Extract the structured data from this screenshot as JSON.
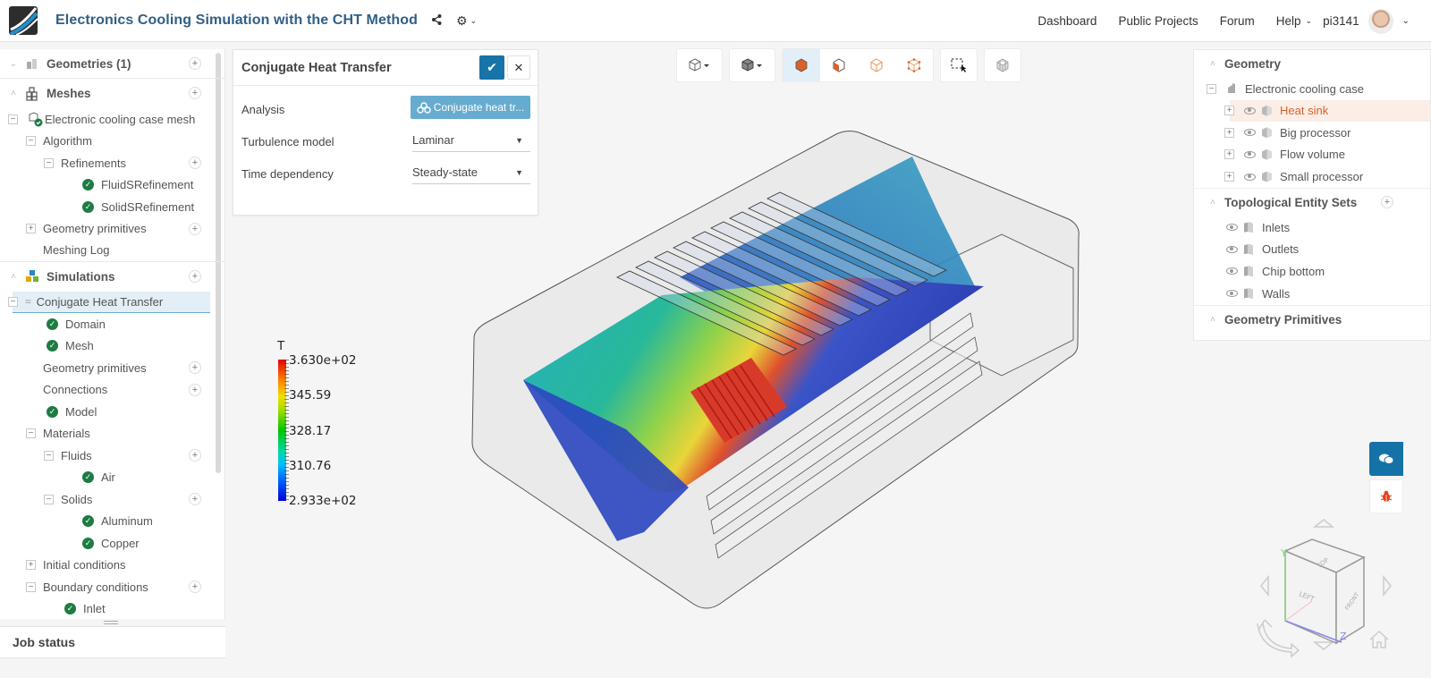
{
  "header": {
    "title": "Electronics Cooling Simulation with the CHT Method",
    "share_icon": "share-icon",
    "settings_icon": "gear-icon",
    "nav": [
      "Dashboard",
      "Public Projects",
      "Forum",
      "Help"
    ],
    "username": "pi3141"
  },
  "sidebar": {
    "geometries": "Geometries (1)",
    "meshes": "Meshes",
    "mesh_item": "Electronic cooling case mesh",
    "algorithm": "Algorithm",
    "refinements": "Refinements",
    "refinement_items": [
      "FluidSRefinement",
      "SolidSRefinement"
    ],
    "geometry_primitives": "Geometry primitives",
    "meshing_log": "Meshing Log",
    "simulations": "Simulations",
    "simulation_item": "Conjugate Heat Transfer",
    "domain": "Domain",
    "mesh": "Mesh",
    "sim_geometry_primitives": "Geometry primitives",
    "connections": "Connections",
    "model": "Model",
    "materials": "Materials",
    "fluids": "Fluids",
    "air": "Air",
    "solids": "Solids",
    "aluminum": "Aluminum",
    "copper": "Copper",
    "initial_conditions": "Initial conditions",
    "boundary_conditions": "Boundary conditions",
    "inlet": "Inlet",
    "job_status": "Job status"
  },
  "dialog": {
    "title": "Conjugate Heat Transfer",
    "analysis_label": "Analysis",
    "analysis_value": "Conjugate heat tr...",
    "turbulence_label": "Turbulence model",
    "turbulence_value": "Laminar",
    "time_label": "Time dependency",
    "time_value": "Steady-state"
  },
  "right_panel": {
    "geometry": "Geometry",
    "case": "Electronic cooling case",
    "parts": [
      "Heat sink",
      "Big processor",
      "Flow volume",
      "Small processor"
    ],
    "selected_part": "Heat sink",
    "topo_sets": "Topological Entity Sets",
    "sets": [
      "Inlets",
      "Outlets",
      "Chip bottom",
      "Walls"
    ],
    "geometry_primitives": "Geometry Primitives"
  },
  "colorbar": {
    "variable": "T",
    "labels": [
      "3.630e+02",
      "345.59",
      "328.17",
      "310.76",
      "2.933e+02"
    ],
    "max": 363.0,
    "min": 293.3
  },
  "viewcube": {
    "top": "TOP",
    "left": "LEFT",
    "front": "FRONT",
    "axis_y": "Y",
    "axis_z": "Z"
  },
  "colors": {
    "accent": "#1773a8",
    "title": "#2f5f86",
    "selected_part": "#d9622b",
    "check": "#1e7b43"
  }
}
